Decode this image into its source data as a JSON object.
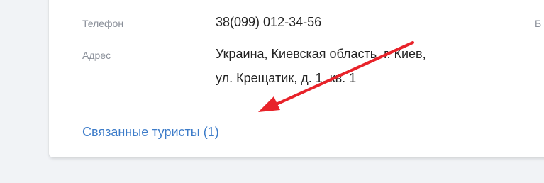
{
  "contact": {
    "phone_label": "Телефон",
    "phone_value": "38(099) 012-34-56",
    "address_label": "Адрес",
    "address_line1": "Украина, Киевская область, г. Киев,",
    "address_line2": "ул. Крещатик, д. 1, кв. 1",
    "clipped_right_label": "Б"
  },
  "related": {
    "link_label": "Связанные туристы (1)"
  },
  "colors": {
    "link": "#3d7cc9",
    "annotation_arrow": "#e8232a"
  }
}
